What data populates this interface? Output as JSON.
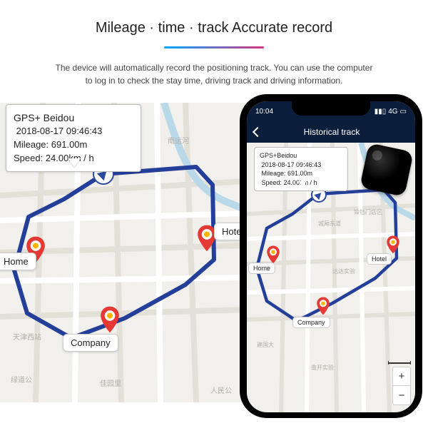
{
  "title": "Mileage · time · track  Accurate record",
  "subtitle_line1": "The device will automatically record the positioning track. You can use the computer",
  "subtitle_line2": "to log in to check the stay time, driving track and driving information.",
  "infobox": {
    "mode": "GPS+ Beidou",
    "timestamp": "2018-08-17 09:46:43",
    "mileage_label": "Mileage:",
    "mileage_value": "691.00m",
    "speed_label": "Speed:",
    "speed_value": "24.00km / h"
  },
  "pins": {
    "home": "Home",
    "hotel": "Hotel",
    "company": "Company"
  },
  "phone": {
    "time": "10:04",
    "network": "4G",
    "nav_title": "Historical track",
    "infobox": {
      "mode": "GPS+Beidou",
      "timestamp": "2018-08-17 09:46:43",
      "mileage": "Mileage: 691.00m",
      "speed": "Speed: 24.00km / h"
    },
    "pins": {
      "home": "Home",
      "hotel": "Hotel",
      "company": "Company"
    },
    "zoom_in": "+",
    "zoom_out": "−"
  },
  "cjk": {
    "a": "南运河",
    "b": "天津西站",
    "c": "人民公",
    "d": "佳园里",
    "e": "绿道公",
    "f": "城厢东道",
    "g": "铃铛门店区",
    "h": "达达实验",
    "i": "建国大",
    "j": "南开实验"
  }
}
